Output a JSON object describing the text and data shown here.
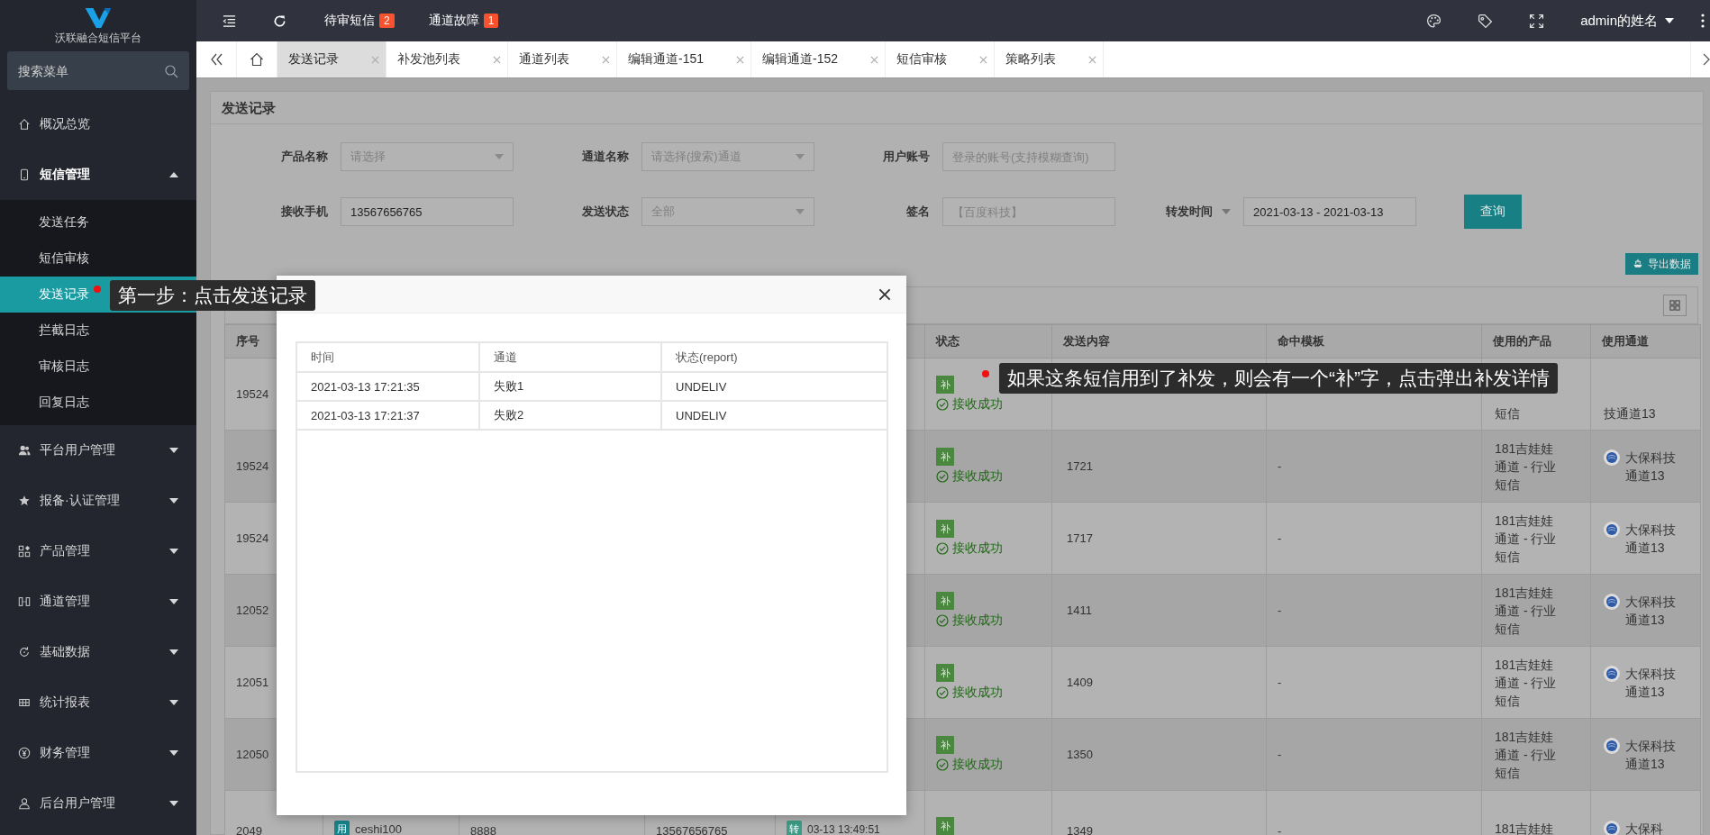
{
  "sidebar": {
    "app_name": "沃联融合短信平台",
    "search": {
      "placeholder": "搜索菜单"
    },
    "items": [
      {
        "label": "概况总览"
      },
      {
        "label": "短信管理",
        "expanded": true,
        "children": [
          {
            "label": "发送任务",
            "selected": false
          },
          {
            "label": "短信审核",
            "selected": false
          },
          {
            "label": "发送记录",
            "selected": true
          },
          {
            "label": "拦截日志",
            "selected": false
          },
          {
            "label": "审核日志",
            "selected": false
          },
          {
            "label": "回复日志",
            "selected": false
          }
        ]
      },
      {
        "label": "平台用户管理",
        "expanded": false
      },
      {
        "label": "报备·认证管理",
        "expanded": false
      },
      {
        "label": "产品管理",
        "expanded": false
      },
      {
        "label": "通道管理",
        "expanded": false
      },
      {
        "label": "基础数据",
        "expanded": false
      },
      {
        "label": "统计报表",
        "expanded": false
      },
      {
        "label": "财务管理",
        "expanded": false
      },
      {
        "label": "后台用户管理",
        "expanded": false
      }
    ]
  },
  "top_bar": {
    "links": [
      {
        "label": "待审短信",
        "count": "2"
      },
      {
        "label": "通道故障",
        "count": "1"
      }
    ],
    "user": "admin的姓名"
  },
  "tabs": [
    {
      "label": "发送记录",
      "selected": true
    },
    {
      "label": "补发池列表",
      "selected": false
    },
    {
      "label": "通道列表",
      "selected": false
    },
    {
      "label": "编辑通道-151",
      "selected": false
    },
    {
      "label": "编辑通道-152",
      "selected": false
    },
    {
      "label": "短信审核",
      "selected": false
    },
    {
      "label": "策略列表",
      "selected": false
    }
  ],
  "page": {
    "title": "发送记录",
    "filters": [
      {
        "kind": "select",
        "label": "产品名称",
        "placeholder": "请选择"
      },
      {
        "kind": "select",
        "label": "通道名称",
        "placeholder": "请选择(搜索)通道"
      },
      {
        "kind": "input",
        "label": "用户账号",
        "placeholder": "登录的账号(支持模糊查询)"
      },
      {
        "kind": "input",
        "label": "接收手机",
        "value": "13567656765"
      },
      {
        "kind": "select",
        "label": "发送状态",
        "placeholder": "全部"
      },
      {
        "kind": "input",
        "label": "签名",
        "placeholder": "【百度科技】"
      },
      {
        "kind": "range",
        "label": "转发时间",
        "value": "2021-03-13 - 2021-03-13"
      }
    ],
    "query_button": "查询",
    "export_button": "导出数据",
    "table": {
      "columns": [
        "序号",
        "状态",
        "发送内容",
        "命中模板",
        "使用的产品",
        "使用通道"
      ],
      "rows": [
        {
          "id": "19524",
          "status": {
            "badge": "补",
            "text": "接收成功"
          },
          "product": "短信",
          "channel": {
            "logo": false,
            "text": "技通道13"
          }
        },
        {
          "id": "19524",
          "status": {
            "badge": "补",
            "text": "接收成功"
          },
          "content": "1721",
          "template": "-",
          "product": "181吉娃娃通道 - 行业短信",
          "channel": {
            "logo": true,
            "text": "大保科技通道13"
          }
        },
        {
          "id": "19524",
          "status": {
            "badge": "补",
            "text": "接收成功"
          },
          "content": "1717",
          "template": "-",
          "product": "181吉娃娃通道 - 行业短信",
          "channel": {
            "logo": true,
            "text": "大保科技通道13"
          }
        },
        {
          "id": "12052",
          "status": {
            "badge": "补",
            "text": "接收成功"
          },
          "content": "1411",
          "template": "-",
          "product": "181吉娃娃通道 - 行业短信",
          "channel": {
            "logo": true,
            "text": "大保科技通道13"
          }
        },
        {
          "id": "12051",
          "status": {
            "badge": "补",
            "text": "接收成功"
          },
          "content": "1409",
          "template": "-",
          "product": "181吉娃娃通道 - 行业短信",
          "channel": {
            "logo": true,
            "text": "大保科技通道13"
          }
        },
        {
          "id": "12050",
          "status": {
            "badge": "补",
            "text": "接收成功"
          },
          "content": "1350",
          "template": "-",
          "product": "181吉娃娃通道 - 行业短信",
          "channel": {
            "logo": true,
            "text": "大保科技通道13"
          }
        },
        {
          "id": "2049",
          "column_2": {
            "badge": "用",
            "text": "ceshi100"
          },
          "column_3": "8888",
          "column_4": "13567656765",
          "column_5": {
            "tag": "转",
            "text": "03-13 13:49:51"
          },
          "status": {
            "badge": "补"
          },
          "content": "1349",
          "template": "-",
          "product": "181吉娃娃",
          "channel": {
            "logo": true,
            "text": "大保科"
          }
        }
      ]
    }
  },
  "modal": {
    "columns": [
      "时间",
      "通道",
      "状态(report)"
    ],
    "rows": [
      [
        "2021-03-13 17:21:35",
        "失败1",
        "UNDELIV"
      ],
      [
        "2021-03-13 17:21:37",
        "失败2",
        "UNDELIV"
      ]
    ]
  },
  "annotations": [
    {
      "text": "第一步：点击发送记录"
    },
    {
      "text": "如果这条短信用到了补发，则会有一个“补”字，点击弹出补发详情"
    }
  ]
}
